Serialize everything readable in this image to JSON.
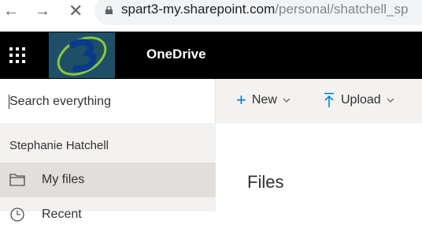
{
  "browser": {
    "url_domain": "spart3-my.sharepoint.com",
    "url_path": "/personal/shatchell_sp"
  },
  "suite": {
    "app_title": "OneDrive"
  },
  "search": {
    "placeholder": "Search everything"
  },
  "commands": {
    "new_label": "New",
    "upload_label": "Upload"
  },
  "nav": {
    "user_name": "Stephanie Hatchell",
    "items": [
      {
        "label": "My files",
        "icon": "folder-icon",
        "selected": true
      },
      {
        "label": "Recent",
        "icon": "clock-icon",
        "selected": false
      }
    ]
  },
  "main": {
    "title": "Files"
  },
  "colors": {
    "suite_bar": "#000000",
    "accent": "#0078d4",
    "nav_bg": "#f3f2f1",
    "selected_bg": "#e1dfdd"
  }
}
